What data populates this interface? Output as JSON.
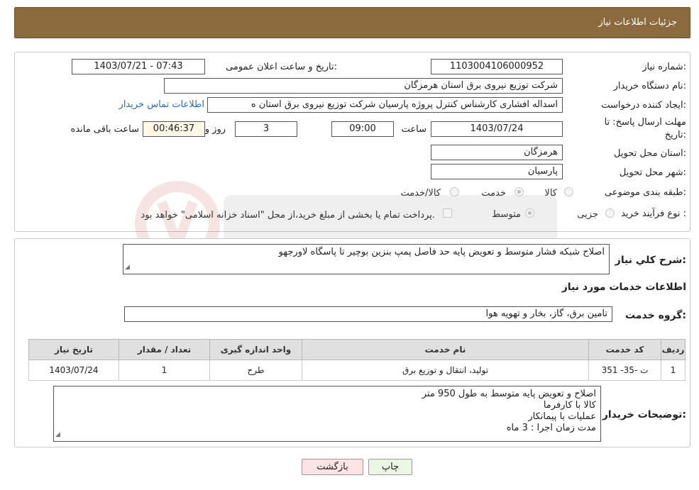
{
  "header": {
    "title": "جزئیات اطلاعات نیاز"
  },
  "form": {
    "need_number_label": "شماره نیاز:",
    "need_number": "1103004106000952",
    "announce_label": "تاریخ و ساعت اعلان عمومی:",
    "announce_value": "1403/07/21 - 07:43",
    "buyer_org_label": "نام دستگاه خریدار:",
    "buyer_org": "شرکت توزیع نیروی برق استان هرمزگان",
    "requester_label": "ایجاد کننده درخواست:",
    "requester": "اسداله افشاری کارشناس کنترل پروژه پارسیان شرکت توزیع نیروی برق استان ه",
    "contact_link": "اطلاعات تماس خریدار",
    "deadline_label_1": "مهلت ارسال پاسخ: تا",
    "deadline_label_2": "تاریخ:",
    "deadline_date": "1403/07/24",
    "time_label": "ساعت",
    "deadline_time": "09:00",
    "days": "3",
    "days_label": "روز و",
    "remaining_time": "00:46:37",
    "remaining_label": "ساعت باقی مانده",
    "province_label": "استان محل تحویل:",
    "province": "هرمزگان",
    "city_label": "شهر محل تحویل:",
    "city": "پارسیان",
    "category_label": "طبقه بندی موضوعی:",
    "category_options": [
      "کالا",
      "خدمت",
      "کالا/خدمت"
    ],
    "category_selected": "خدمت",
    "process_label": "نوع فرآیند خرید :",
    "process_options": [
      "جزیی",
      "متوسط"
    ],
    "process_selected": "متوسط",
    "payment_note": "پرداخت تمام یا بخشی از مبلغ خرید،از محل \"اسناد خزانه اسلامی\" خواهد بود."
  },
  "summary": {
    "label": "شرح کلي نياز:",
    "text": "اصلاح شبکه فشار متوسط و تعویض پایه حد فاصل پمپ بنزین بوچیر تا پاسگاه لاورجهو",
    "services_title": "اطلاعات خدمات مورد نیاز",
    "group_label": "گروه خدمت:",
    "group_value": "تامین برق، گاز، بخار و تهویه هوا"
  },
  "table": {
    "headers": [
      "ردیف",
      "کد خدمت",
      "نام خدمت",
      "واحد اندازه گیری",
      "تعداد / مقدار",
      "تاریخ نیاز"
    ],
    "rows": [
      [
        "1",
        "ت -35- 351",
        "تولید، انتقال و توزیع برق",
        "طرح",
        "1",
        "1403/07/24"
      ]
    ]
  },
  "buyer_notes": {
    "label": "توضیحات خریدار:",
    "lines": [
      "اصلاح و تعویض پایه متوسط به طول 950 متر",
      "کالا با کارفرما",
      "عملیات با پیمانکار",
      "مدت زمان اجرا : 3 ماه"
    ]
  },
  "buttons": {
    "print": "چاپ",
    "back": "بازگشت"
  },
  "colors": {
    "header_bg": "#8b6a3e",
    "link": "#2a6ebb",
    "back_button_bg": "#fbe3e3",
    "print_button_bg": "#eaf5e4"
  }
}
